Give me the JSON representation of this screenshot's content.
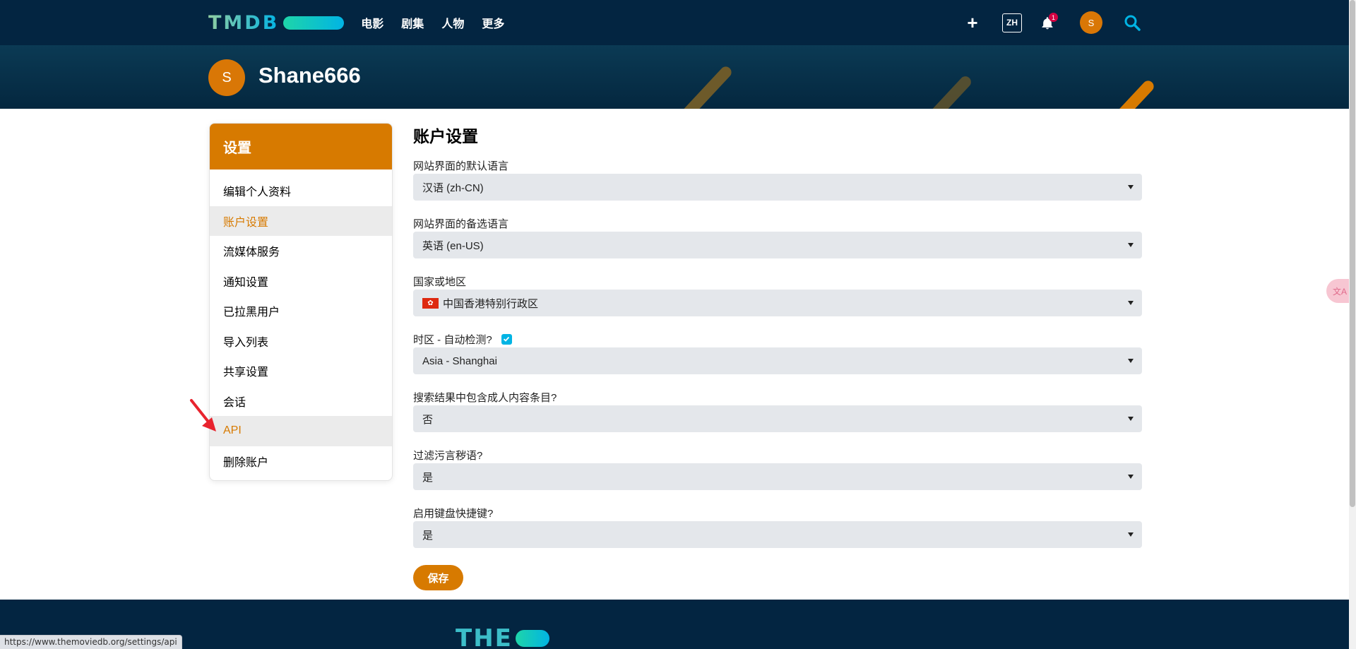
{
  "nav": {
    "logo_text": "TMDB",
    "menu": [
      "电影",
      "剧集",
      "人物",
      "更多"
    ],
    "plus_label": "+",
    "lang_label": "ZH",
    "notification_count": "1",
    "avatar_initial": "S"
  },
  "header": {
    "avatar_initial": "S",
    "username": "Shane666"
  },
  "sidebar": {
    "title": "设置",
    "items": [
      {
        "label": "编辑个人资料",
        "active": false
      },
      {
        "label": "账户设置",
        "active": true
      },
      {
        "label": "流媒体服务",
        "active": false
      },
      {
        "label": "通知设置",
        "active": false
      },
      {
        "label": "已拉黑用户",
        "active": false
      },
      {
        "label": "导入列表",
        "active": false
      },
      {
        "label": "共享设置",
        "active": false
      },
      {
        "label": "会话",
        "active": false
      },
      {
        "label": "API",
        "active": true
      },
      {
        "label": "删除账户",
        "active": false
      }
    ]
  },
  "main": {
    "title": "账户设置",
    "fields": [
      {
        "label": "网站界面的默认语言",
        "value": "汉语 (zh-CN)"
      },
      {
        "label": "网站界面的备选语言",
        "value": "英语 (en-US)"
      },
      {
        "label": "国家或地区",
        "value": "中国香港特别行政区",
        "flag": "hk-flag-icon"
      },
      {
        "label": "时区 - 自动检测?",
        "value": "Asia - Shanghai",
        "checkbox_checked": true
      },
      {
        "label": "搜索结果中包含成人内容条目?",
        "value": "否"
      },
      {
        "label": "过滤污言秽语?",
        "value": "是"
      },
      {
        "label": "启用键盘快捷键?",
        "value": "是"
      }
    ],
    "save_label": "保存"
  },
  "footer": {
    "logo_text": "THE"
  },
  "status_url": "https://www.themoviedb.org/settings/api",
  "colors": {
    "nav_bg": "#032541",
    "accent": "#d77a00",
    "tmdb_blue": "#01b4e4",
    "select_bg": "#e4e7eb"
  }
}
